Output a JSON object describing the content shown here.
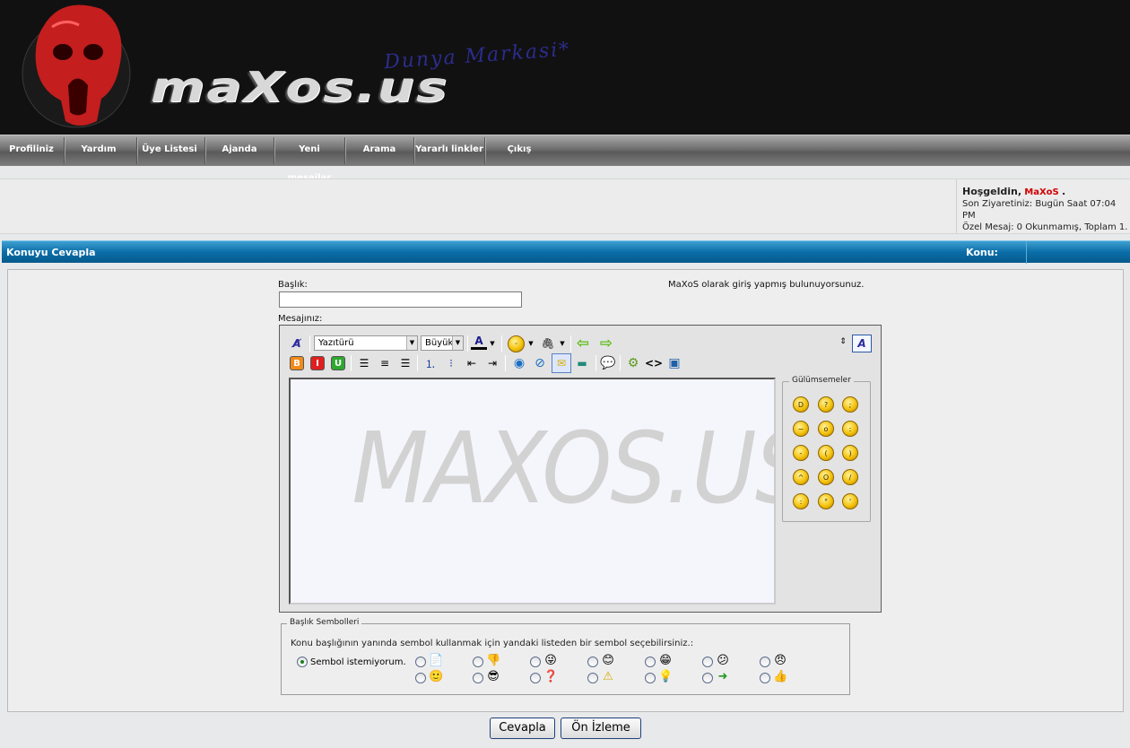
{
  "banner": {
    "logo_text": "maXos.us",
    "logo_subtext": "Dunya Markasi*"
  },
  "nav": {
    "items": [
      "Profiliniz",
      "Yardım",
      "Üye Listesi",
      "Ajanda",
      "Yeni mesajlar",
      "Arama",
      "Yararlı linkler",
      "Çıkış"
    ]
  },
  "welcome": {
    "greeting": "Hoşgeldin,",
    "username": "MaXoS",
    "dot": ".",
    "last_visit": "Son Ziyaretiniz: Bugün Saat 07:04 PM",
    "private_messages": "Özel Mesaj: 0 Okunmamış, Toplam 1."
  },
  "thread_header": {
    "title": "Konuyu Cevapla",
    "konu_label": "Konu:"
  },
  "form": {
    "title_label": "Başlık:",
    "title_value": "",
    "message_label": "Mesajınız:",
    "logged_in_text": "MaXoS olarak giriş yapmış bulunuyorsunuz."
  },
  "editor": {
    "font_select": "Yazıtürü",
    "size_select": "Büyük",
    "watermark": "MAXOS.US",
    "smilies_legend": "Gülümsemeler"
  },
  "icons": {
    "toolbar": [
      "remove-format-icon",
      "text-color-icon",
      "smiley-menu-icon",
      "attachment-icon",
      "undo-icon",
      "redo-icon",
      "bold-icon",
      "italic-icon",
      "underline-icon",
      "align-left-icon",
      "align-center-icon",
      "align-right-icon",
      "ordered-list-icon",
      "unordered-list-icon",
      "outdent-icon",
      "indent-icon",
      "link-icon",
      "unlink-icon",
      "email-icon",
      "image-icon",
      "quote-icon",
      "code-icon",
      "html-icon",
      "php-icon",
      "resize-icon",
      "switch-mode-icon"
    ]
  },
  "symbols": {
    "legend": "Başlık Sembolleri",
    "description": "Konu başlığının yanında sembol kullanmak için yandaki listeden bir sembol seçebilirsiniz.:",
    "none_label": "Sembol istemiyorum.",
    "row1": [
      "📄",
      "👎",
      "😜",
      "😊",
      "😁",
      "😕",
      "😠"
    ],
    "row2": [
      "🙂",
      "😎",
      "❓",
      "⚠",
      "💡",
      "➜",
      "👍"
    ]
  },
  "buttons": {
    "submit": "Cevapla",
    "preview": "Ön İzleme"
  },
  "colors": {
    "header_blue": "#0b6ea8",
    "username_red": "#d10000",
    "banner_black": "#111111"
  }
}
